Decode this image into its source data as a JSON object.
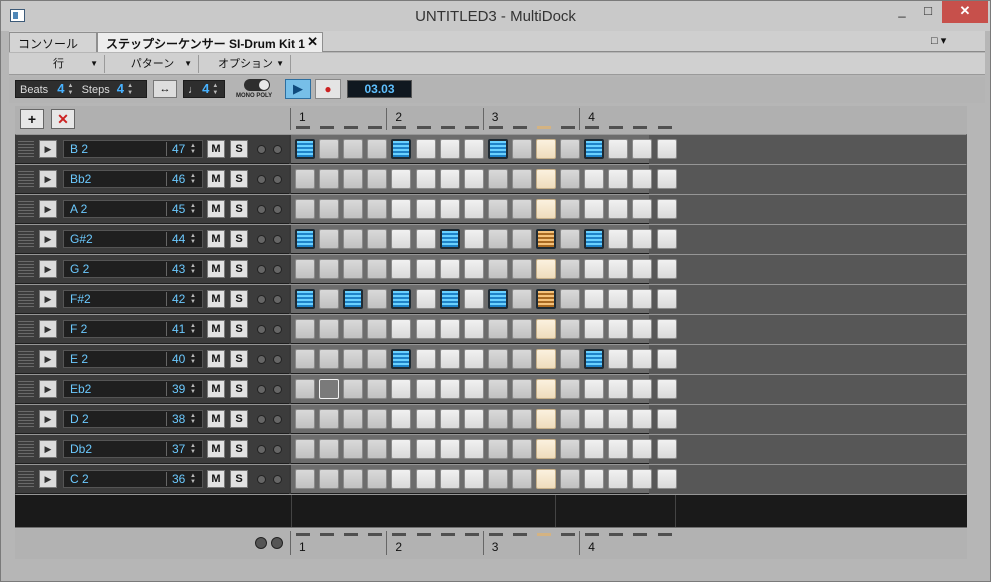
{
  "window": {
    "title": "UNTITLED3 - MultiDock",
    "controls": [
      "_",
      "□",
      "✕"
    ]
  },
  "tabs": [
    {
      "label": "コンソール",
      "active": false
    },
    {
      "label": "ステップシーケンサー  SI-Drum Kit 1",
      "active": true,
      "close": "✕"
    }
  ],
  "dock_menu": "□ ▾",
  "menus": [
    {
      "label": "行"
    },
    {
      "label": "パターン"
    },
    {
      "label": "オプション"
    }
  ],
  "toolbar": {
    "beats_label": "Beats",
    "beats_value": "4",
    "steps_label": "Steps",
    "steps_value": "4",
    "note_value": "4",
    "mono_poly_label": "MONO POLY",
    "time": "03.03"
  },
  "grid": {
    "beat_labels": [
      "1",
      "2",
      "3",
      "4"
    ],
    "add_button": "+",
    "delete_button": "✕",
    "mute_label": "M",
    "solo_label": "S",
    "cursor_step": 10,
    "rows": [
      {
        "name": "B 2",
        "number": "47",
        "steps": [
          1,
          0,
          0,
          0,
          1,
          0,
          0,
          0,
          1,
          0,
          0,
          0,
          1,
          0,
          0,
          0
        ]
      },
      {
        "name": "Bb2",
        "number": "46",
        "steps": [
          0,
          0,
          0,
          0,
          0,
          0,
          0,
          0,
          0,
          0,
          0,
          0,
          0,
          0,
          0,
          0
        ]
      },
      {
        "name": "A 2",
        "number": "45",
        "steps": [
          0,
          0,
          0,
          0,
          0,
          0,
          0,
          0,
          0,
          0,
          0,
          0,
          0,
          0,
          0,
          0
        ]
      },
      {
        "name": "G#2",
        "number": "44",
        "steps": [
          1,
          0,
          0,
          0,
          0,
          0,
          1,
          0,
          0,
          0,
          1,
          0,
          1,
          0,
          0,
          0
        ]
      },
      {
        "name": "G 2",
        "number": "43",
        "steps": [
          0,
          0,
          0,
          0,
          0,
          0,
          0,
          0,
          0,
          0,
          0,
          0,
          0,
          0,
          0,
          0
        ]
      },
      {
        "name": "F#2",
        "number": "42",
        "steps": [
          1,
          0,
          1,
          0,
          1,
          0,
          1,
          0,
          1,
          0,
          1,
          0,
          0,
          0,
          0,
          0
        ]
      },
      {
        "name": "F 2",
        "number": "41",
        "steps": [
          0,
          0,
          0,
          0,
          0,
          0,
          0,
          0,
          0,
          0,
          0,
          0,
          0,
          0,
          0,
          0
        ]
      },
      {
        "name": "E 2",
        "number": "40",
        "steps": [
          0,
          0,
          0,
          0,
          1,
          0,
          0,
          0,
          0,
          0,
          0,
          0,
          1,
          0,
          0,
          0
        ]
      },
      {
        "name": "Eb2",
        "number": "39",
        "steps": [
          0,
          2,
          0,
          0,
          0,
          0,
          0,
          0,
          0,
          0,
          0,
          0,
          0,
          0,
          0,
          0
        ]
      },
      {
        "name": "D 2",
        "number": "38",
        "steps": [
          0,
          0,
          0,
          0,
          0,
          0,
          0,
          0,
          0,
          0,
          0,
          0,
          0,
          0,
          0,
          0
        ]
      },
      {
        "name": "Db2",
        "number": "37",
        "steps": [
          0,
          0,
          0,
          0,
          0,
          0,
          0,
          0,
          0,
          0,
          0,
          0,
          0,
          0,
          0,
          0
        ]
      },
      {
        "name": "C 2",
        "number": "36",
        "steps": [
          0,
          0,
          0,
          0,
          0,
          0,
          0,
          0,
          0,
          0,
          0,
          0,
          0,
          0,
          0,
          0
        ]
      }
    ]
  },
  "colors": {
    "step_on": "#4fbfff",
    "cursor": "#f4dfbd",
    "record": "#cc2222",
    "play": "#77bfe8"
  }
}
